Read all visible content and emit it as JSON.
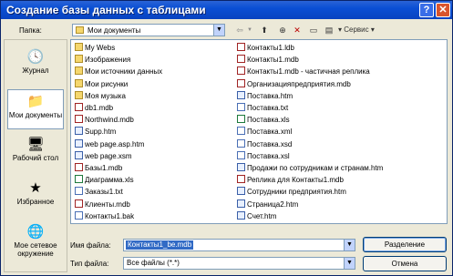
{
  "window": {
    "title": "Создание базы данных с таблицами"
  },
  "toolbar": {
    "lookin_label": "Папка:",
    "lookin_value": "Мои документы",
    "tools_label": "Сервис"
  },
  "places": [
    {
      "label": "Журнал"
    },
    {
      "label": "Мои документы"
    },
    {
      "label": "Рабочий стол"
    },
    {
      "label": "Избранное"
    },
    {
      "label": "Мое сетевое окружение"
    }
  ],
  "files": {
    "col1": [
      {
        "name": "My Webs",
        "type": "folder"
      },
      {
        "name": "Изображения",
        "type": "folder"
      },
      {
        "name": "Мои источники данных",
        "type": "folder"
      },
      {
        "name": "Мои рисунки",
        "type": "folder"
      },
      {
        "name": "Моя музыка",
        "type": "folder"
      },
      {
        "name": "db1.mdb",
        "type": "db"
      },
      {
        "name": "Northwind.mdb",
        "type": "db"
      },
      {
        "name": "Supp.htm",
        "type": "web"
      },
      {
        "name": "web page.asp.htm",
        "type": "web"
      },
      {
        "name": "web page.xsm",
        "type": "web"
      },
      {
        "name": "Базы1.mdb",
        "type": "db"
      },
      {
        "name": "Диаграмма.xls",
        "type": "xls"
      },
      {
        "name": "Заказы1.txt",
        "type": "doc"
      },
      {
        "name": "Клиенты.mdb",
        "type": "db"
      },
      {
        "name": "Контакты1.bak",
        "type": "doc"
      }
    ],
    "col2": [
      {
        "name": "Контакты1.ldb",
        "type": "db"
      },
      {
        "name": "Контакты1.mdb",
        "type": "db"
      },
      {
        "name": "Контакты1.mdb - частичная реплика",
        "type": "db"
      },
      {
        "name": "Организацияпредприятия.mdb",
        "type": "db"
      },
      {
        "name": "Поставка.htm",
        "type": "web"
      },
      {
        "name": "Поставка.txt",
        "type": "doc"
      },
      {
        "name": "Поставка.xls",
        "type": "xls"
      },
      {
        "name": "Поставка.xml",
        "type": "doc"
      },
      {
        "name": "Поставка.xsd",
        "type": "doc"
      },
      {
        "name": "Поставка.xsl",
        "type": "doc"
      },
      {
        "name": "Продажи по сотрудникам и странам.htm",
        "type": "web"
      },
      {
        "name": "Реплика для Контакты1.mdb",
        "type": "db"
      },
      {
        "name": "Сотрудники предприятия.htm",
        "type": "web"
      },
      {
        "name": "Страница2.htm",
        "type": "web"
      },
      {
        "name": "Счет.htm",
        "type": "web"
      }
    ]
  },
  "filename": {
    "label": "Имя файла:",
    "value": "Контакты1_be.mdb"
  },
  "filetype": {
    "label": "Тип файла:",
    "value": "Все файлы (*.*)"
  },
  "buttons": {
    "create": "Разделение",
    "cancel": "Отмена"
  }
}
